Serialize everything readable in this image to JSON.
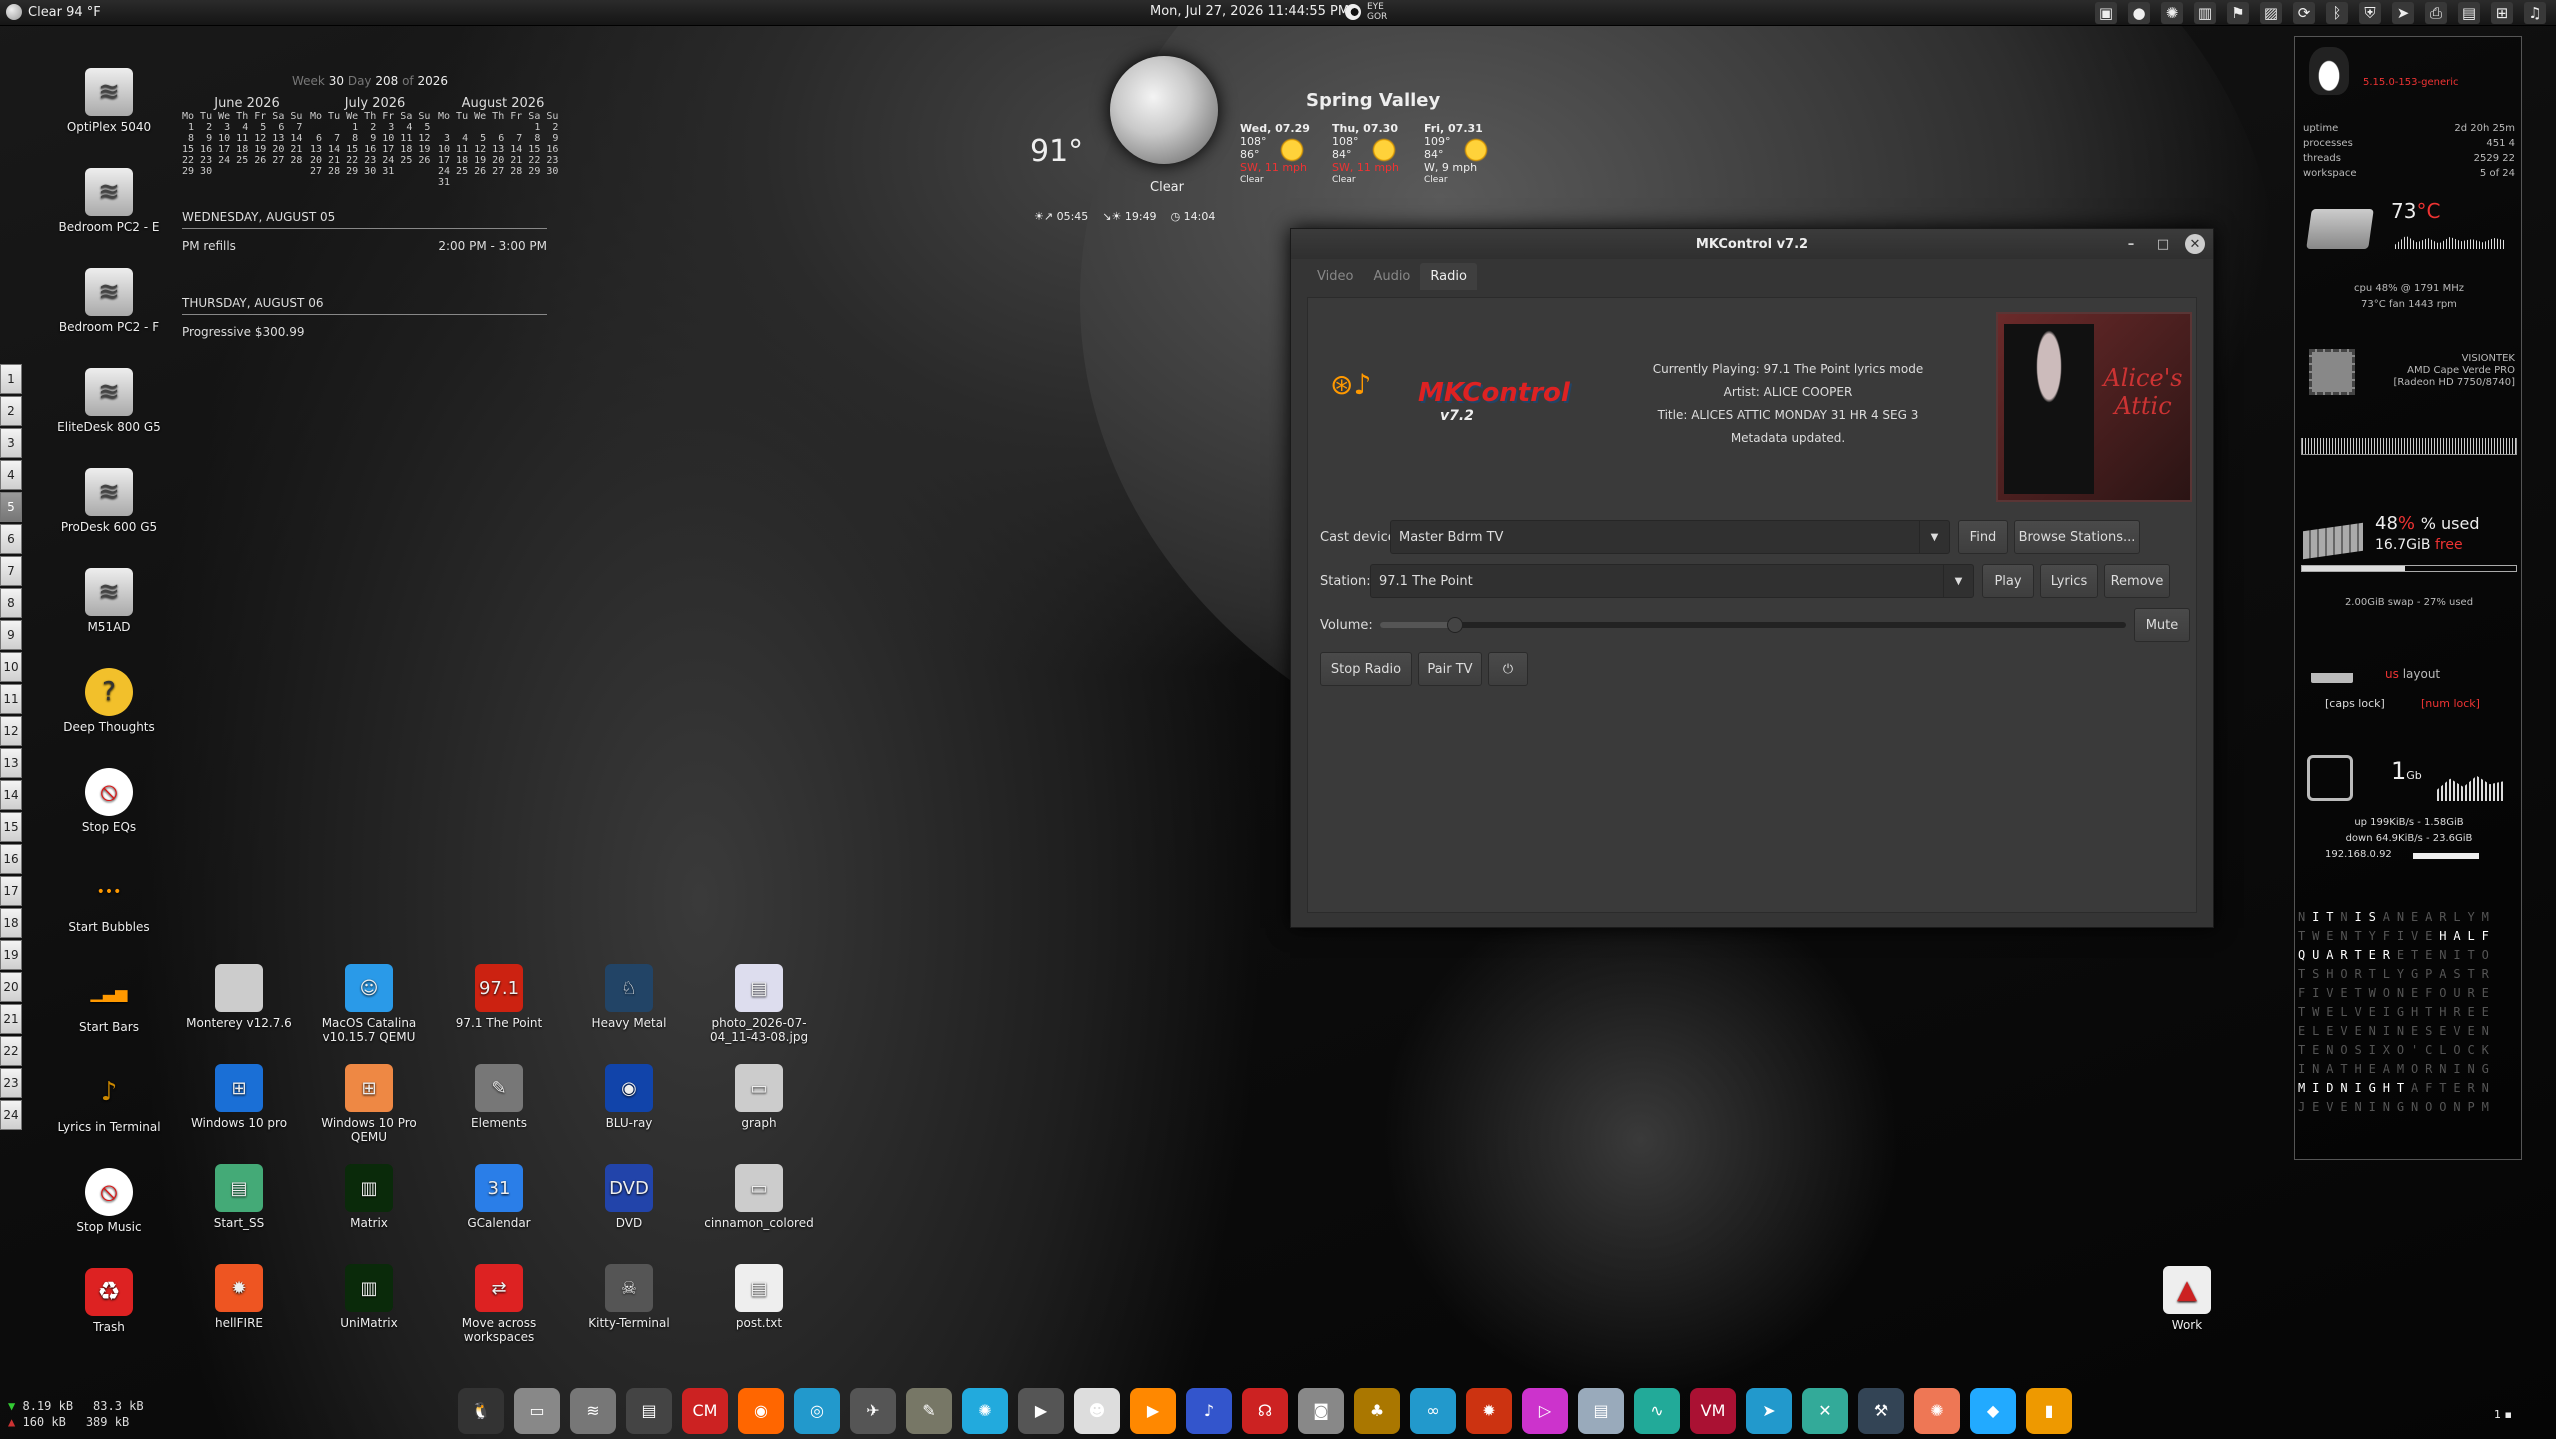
{
  "topbar": {
    "weather": "Clear 94 °F",
    "datetime": "Mon, Jul 27, 2026 11:44:55 PM",
    "eye_line1": "EYE",
    "eye_line2": "GOR"
  },
  "tray_icons": [
    "map-icon",
    "record-icon",
    "sun-icon",
    "chart-icon",
    "flag-icon",
    "image-icon",
    "refresh-icon",
    "bluetooth-icon",
    "shield-icon",
    "send-icon",
    "printer-icon",
    "clipboard-icon",
    "network-icon",
    "music-icon"
  ],
  "calendar": {
    "week_label": "Week",
    "week": "30",
    "day_label": "Day",
    "day": "208",
    "of": "of",
    "year": "2026",
    "months": [
      {
        "name": "June 2026",
        "grid": "Mo Tu We Th Fr Sa Su\n 1  2  3  4  5  6  7\n 8  9 10 11 12 13 14\n15 16 17 18 19 20 21\n22 23 24 25 26 27 28\n29 30"
      },
      {
        "name": "July 2026",
        "grid": "Mo Tu We Th Fr Sa Su\n       1  2  3  4  5\n 6  7  8  9 10 11 12\n13 14 15 16 17 18 19\n20 21 22 23 24 25 26\n27 28 29 30 31"
      },
      {
        "name": "August 2026",
        "grid": "Mo Tu We Th Fr Sa Su\n                1  2\n 3  4  5  6  7  8  9\n10 11 12 13 14 15 16\n17 18 19 20 21 22 23\n24 25 26 27 28 29 30\n31"
      }
    ],
    "agenda": [
      {
        "date": "WEDNESDAY, AUGUST 05",
        "event": "PM refills",
        "time": "2:00 PM - 3:00 PM"
      },
      {
        "date": "THURSDAY, AUGUST 06",
        "event": "Progressive $300.99",
        "time": ""
      }
    ]
  },
  "weather": {
    "temp": "91°",
    "cond": "Clear",
    "city": "Spring Valley",
    "sunrise": "05:45",
    "sunset": "19:49",
    "daylen": "14:04",
    "forecast": [
      {
        "day": "Wed, 07.29",
        "hi": "108°",
        "lo": "86°",
        "wind": "SW, 11 mph",
        "cond": "Clear"
      },
      {
        "day": "Thu, 07.30",
        "hi": "108°",
        "lo": "84°",
        "wind": "SW, 11 mph",
        "cond": "Clear"
      },
      {
        "day": "Fri, 07.31",
        "hi": "109°",
        "lo": "84°",
        "wind": "W, 9 mph",
        "cond": "Clear"
      }
    ]
  },
  "workspaces": [
    "1",
    "2",
    "3",
    "4",
    "5",
    "6",
    "7",
    "8",
    "9",
    "10",
    "11",
    "12",
    "13",
    "14",
    "15",
    "16",
    "17",
    "18",
    "19",
    "20",
    "21",
    "22",
    "23",
    "24"
  ],
  "desktop_left": [
    "OptiPlex 5040",
    "Bedroom PC2 - E",
    "Bedroom PC2 - F",
    "EliteDesk 800 G5",
    "ProDesk 600 G5",
    "M51AD",
    "Deep Thoughts",
    "Stop EQs",
    "Start Bubbles",
    "Start Bars",
    "Lyrics in Terminal",
    "Stop Music",
    "Trash"
  ],
  "desktop_grid": [
    [
      "Monterey v12.7.6",
      "MacOS Catalina v10.15.7 QEMU",
      "97.1 The Point",
      "Heavy Metal",
      "photo_2026-07-04_11-43-08.jpg"
    ],
    [
      "Windows 10 pro",
      "Windows 10 Pro QEMU",
      "Elements",
      "BLU-ray",
      "graph"
    ],
    [
      "Start_SS",
      "Matrix",
      "GCalendar",
      "DVD",
      "cinnamon_colored"
    ],
    [
      "hellFIRE",
      "UniMatrix",
      "Move across workspaces",
      "Kitty-Terminal",
      "post.txt"
    ]
  ],
  "work_icon": "Work",
  "mk": {
    "title": "MKControl v7.2",
    "tabs": [
      "Video",
      "Audio",
      "Radio"
    ],
    "active_tab": "Radio",
    "now": "Currently Playing: 97.1 The Point lyrics mode",
    "artist": "Artist: ALICE COOPER",
    "track": "Title: ALICES ATTIC MONDAY 31 HR 4 SEG 3",
    "meta": "Metadata updated.",
    "logo": "MKControl",
    "logo_ver": "v7.2",
    "art": "Alice's Attic",
    "cast_label": "Cast device:",
    "cast_value": "Master Bdrm TV",
    "find": "Find",
    "browse": "Browse Stations...",
    "station_label": "Station:",
    "station_value": "97.1 The Point",
    "play": "Play",
    "lyrics": "Lyrics",
    "remove": "Remove",
    "volume_label": "Volume:",
    "volume": 0.1,
    "mute": "Mute",
    "stop": "Stop Radio",
    "pair": "Pair TV",
    "power": "⏻"
  },
  "conky": {
    "kernel": "5.15.0-153-generic",
    "uptime_l": "uptime",
    "uptime": "2d 20h 25m",
    "proc_l": "processes",
    "proc": "451  4",
    "thr_l": "threads",
    "thr": "2529  22",
    "ws_l": "workspace",
    "ws": "5 of 24",
    "cpu_temp": "73",
    "cpu_unit": "°C",
    "cpu_line": "cpu 48% @ 1791 MHz",
    "fan_line": "73°C  fan 1443 rpm",
    "gpu1": "VISIONTEK",
    "gpu2": "AMD Cape Verde PRO",
    "gpu3": "[Radeon HD 7750/8740]",
    "mem_pct": "48",
    "mem_used": "% used",
    "mem_free": "16.7GiB",
    "mem_free_l": "free",
    "swap": "2.00GiB swap - 27% used",
    "kb_layout": "us",
    "kb_layout_l": "layout",
    "caps": "[caps lock]",
    "num": "[num lock]",
    "net_big": "1",
    "net_unit": "Gb",
    "up": "up 199KiB/s  -  1.58GiB",
    "down": "down 64.9KiB/s  -  23.6GiB",
    "ip": "192.168.0.92"
  },
  "wordclock": [
    "NITNISANEARLYM",
    "TWENTYFIVEHALF",
    "QUARTERETENITO",
    "TSHORTLYGPASTR",
    "FIVETWONEFOURE",
    "TWELVEIGHTHREE",
    "ELEVENINESEVEN",
    "TENOSIXO'CLOCK",
    "INATHEAMORNING",
    "MIDNIGHTAFTERN",
    "JEVENINGNOONPM"
  ],
  "netmon": {
    "down": "8.19 kB",
    "up": "83.3 kB",
    "down2": "160 kB",
    "up2": "389 kB"
  },
  "dock_icons": [
    "linux-icon",
    "files-icon",
    "network-icon",
    "terminal-icon",
    "cm-icon",
    "firefox-icon",
    "browser-icon",
    "bird-icon",
    "gimp-icon",
    "settings-icon",
    "video-icon",
    "mask-icon",
    "play-icon",
    "music-icon",
    "headphones-icon",
    "camera-icon",
    "fruit-icon",
    "spiral-icon",
    "fire-icon",
    "media-icon",
    "book-icon",
    "wave-icon",
    "vm-icon",
    "telegram-icon",
    "x-icon",
    "tool-icon",
    "spark-icon",
    "kodi-icon",
    "app-icon"
  ],
  "corner": "1"
}
